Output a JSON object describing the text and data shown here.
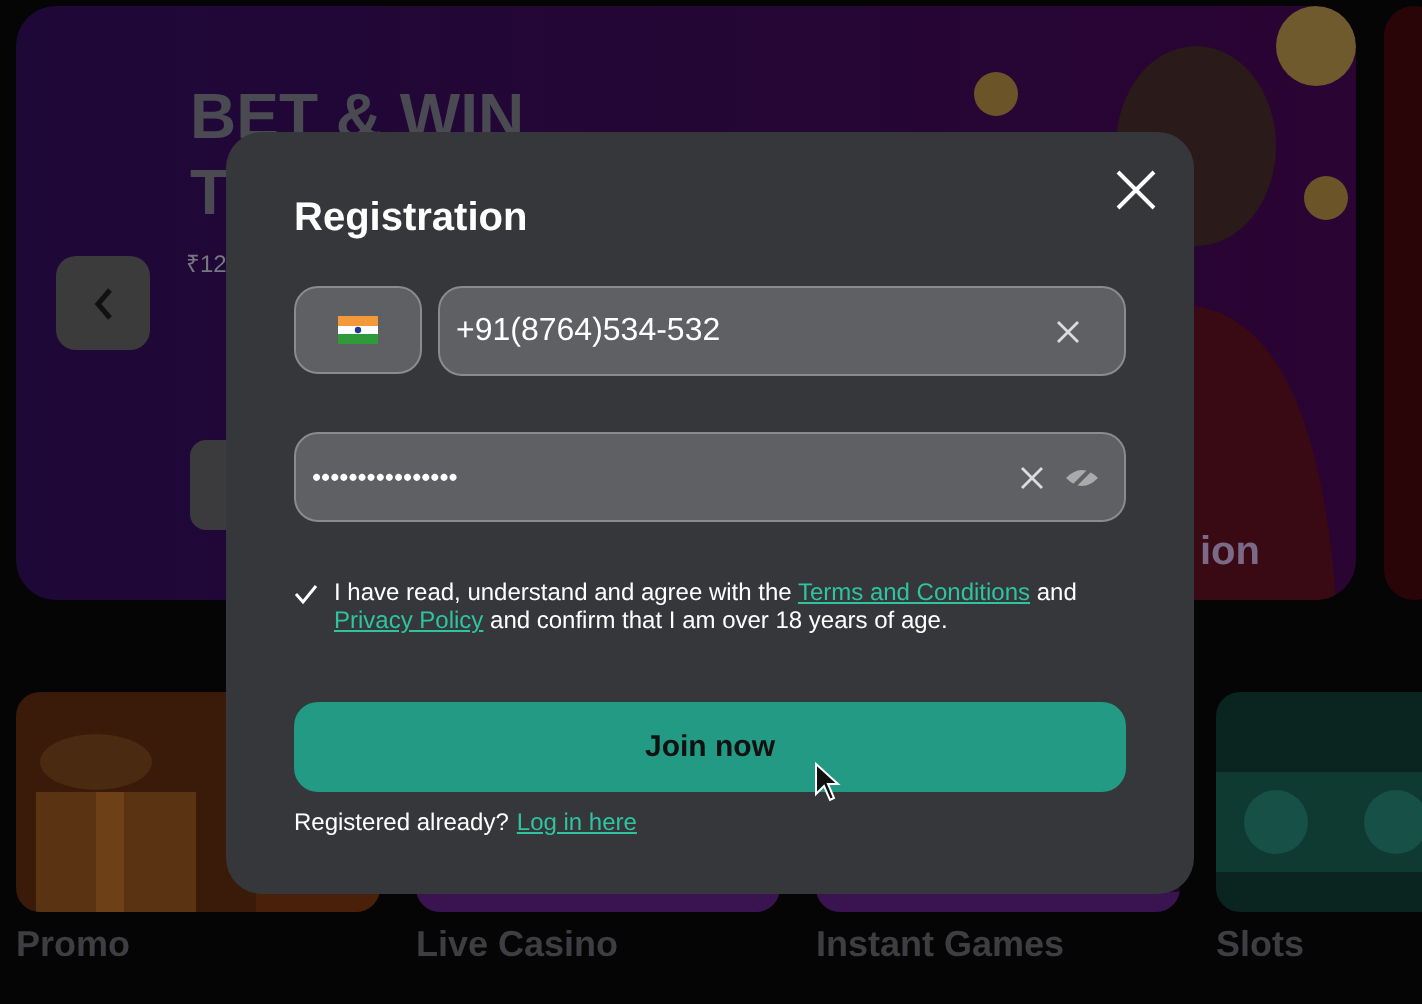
{
  "banner": {
    "title_line_1": "BET & WIN",
    "title_line_2": "T",
    "amount": "₹12",
    "caption": "ion"
  },
  "categories": [
    {
      "label": "Promo",
      "kind": "gift"
    },
    {
      "label": "Live Casino",
      "kind": "live"
    },
    {
      "label": "Instant Games",
      "kind": "instant"
    },
    {
      "label": "Slots",
      "kind": "slots"
    }
  ],
  "modal": {
    "title": "Registration",
    "phone": {
      "value": "+91(8764)534-532"
    },
    "password": {
      "value": "••••••••••••••••"
    },
    "agreement": {
      "checked": true,
      "parts": [
        {
          "kind": "text",
          "text": "I have read, understand and agree with the "
        },
        {
          "kind": "link",
          "text": "Terms and Conditions"
        },
        {
          "kind": "text",
          "text": " and "
        },
        {
          "kind": "link",
          "text": "Privacy Policy"
        },
        {
          "kind": "text",
          "text": " and confirm that I am over 18 years of age."
        }
      ]
    },
    "submit": "Join now",
    "login_prompt": "Registered already?",
    "login_link": "Log in here"
  }
}
